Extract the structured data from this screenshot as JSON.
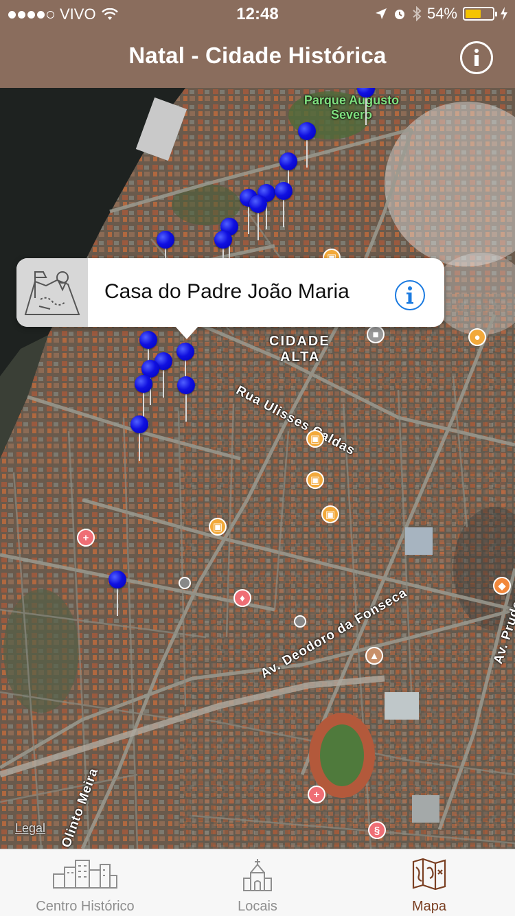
{
  "status": {
    "carrier": "VIVO",
    "time": "12:48",
    "battery_percent": "54%",
    "battery_level": 0.54
  },
  "nav": {
    "title": "Natal - Cidade Histórica",
    "info_icon": "info-circle-icon"
  },
  "map": {
    "labels": {
      "park": "Parque Augusto Severo",
      "district_line1": "CIDADE",
      "district_line2": "ALTA",
      "street1": "Rua Ulisses Caldas",
      "street2": "Av. Deodoro da Fonseca",
      "street3": "Av. Prudente",
      "street4": "Olinto Meira"
    },
    "legal": "Legal",
    "pin_color": "#0a0af0",
    "poi_colors": {
      "shopping": "#f2a93b",
      "hospital": "#ef6e75",
      "pet": "#f2a93b",
      "school": "#c8906a",
      "transit": "#9a9a9a"
    }
  },
  "callout": {
    "title": "Casa do Padre João Maria",
    "thumbnail_icon": "map-location-icon",
    "info_icon": "info-circle-icon"
  },
  "tabs": [
    {
      "label": "Centro Histórico",
      "icon": "city-buildings-icon",
      "active": false
    },
    {
      "label": "Locais",
      "icon": "chapel-icon",
      "active": false
    },
    {
      "label": "Mapa",
      "icon": "folded-map-icon",
      "active": true
    }
  ],
  "colors": {
    "nav_bg": "#8a6d5d",
    "tab_active": "#7a3f22",
    "tab_inactive": "#8e8e8e",
    "callout_info": "#1a7ae0"
  }
}
